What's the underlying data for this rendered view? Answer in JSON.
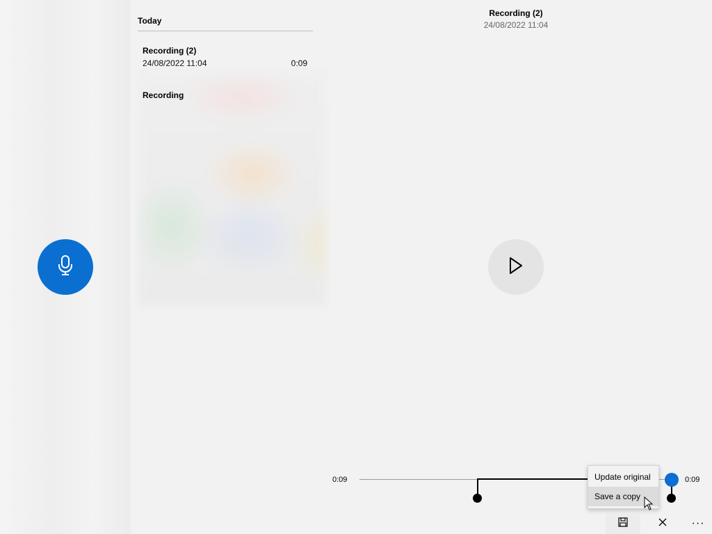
{
  "list": {
    "section_header": "Today",
    "items": [
      {
        "title": "Recording (2)",
        "date": "24/08/2022 11:04",
        "duration": "0:09"
      },
      {
        "title": "Recording"
      }
    ]
  },
  "detail": {
    "title": "Recording (2)",
    "date": "24/08/2022 11:04"
  },
  "timeline": {
    "start_time": "0:09",
    "end_time": "0:09"
  },
  "save_menu": {
    "items": [
      "Update original",
      "Save a copy"
    ]
  },
  "toolbar": {
    "save_icon": "save-icon",
    "close_icon": "close-icon",
    "more_icon": "more-icon",
    "more_label": "···"
  },
  "colors": {
    "accent": "#0a6fd1"
  }
}
